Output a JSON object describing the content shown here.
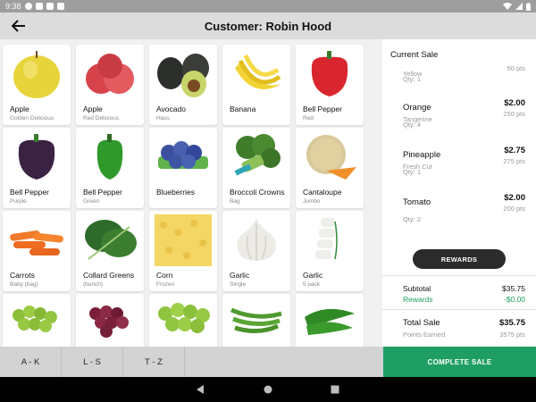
{
  "status_bar": {
    "time": "9:38"
  },
  "header": {
    "title": "Customer: Robin Hood",
    "back_icon": "arrow-left-icon"
  },
  "products": [
    {
      "name": "Apple",
      "sub": "Golden Delicious",
      "icon": "yellow-apple-image"
    },
    {
      "name": "Apple",
      "sub": "Red Delicious",
      "icon": "red-apple-image"
    },
    {
      "name": "Avocado",
      "sub": "Hass",
      "icon": "avocado-image"
    },
    {
      "name": "Banana",
      "sub": "",
      "icon": "banana-image"
    },
    {
      "name": "Bell Pepper",
      "sub": "Red",
      "icon": "red-pepper-image"
    },
    {
      "name": "Bell Pepper",
      "sub": "Purple",
      "icon": "purple-pepper-image"
    },
    {
      "name": "Bell Pepper",
      "sub": "Green",
      "icon": "green-pepper-image"
    },
    {
      "name": "Blueberries",
      "sub": "",
      "icon": "blueberries-image"
    },
    {
      "name": "Broccoli Crowns",
      "sub": "Bag",
      "icon": "broccoli-image"
    },
    {
      "name": "Cantaloupe",
      "sub": "Jumbo",
      "icon": "cantaloupe-image"
    },
    {
      "name": "Carrots",
      "sub": "Baby (bag)",
      "icon": "carrots-image"
    },
    {
      "name": "Collard Greens",
      "sub": "(bunch)",
      "icon": "collard-greens-image"
    },
    {
      "name": "Corn",
      "sub": "Frozen",
      "icon": "corn-image"
    },
    {
      "name": "Garlic",
      "sub": "Single",
      "icon": "garlic-image"
    },
    {
      "name": "Garlic",
      "sub": "5 pack",
      "icon": "garlic-pack-image"
    },
    {
      "name": "",
      "sub": "",
      "icon": "green-grapes-image"
    },
    {
      "name": "",
      "sub": "",
      "icon": "red-grapes-image"
    },
    {
      "name": "",
      "sub": "",
      "icon": "green-grapes-bunch-image"
    },
    {
      "name": "",
      "sub": "",
      "icon": "green-beans-image"
    },
    {
      "name": "",
      "sub": "",
      "icon": "green-chili-image"
    }
  ],
  "sale": {
    "heading": "Current Sale",
    "lines": [
      {
        "name": "",
        "price": "",
        "modifier": "Yellow",
        "points": "50 pts",
        "qty": "Qty: 1"
      },
      {
        "name": "Orange",
        "price": "$2.00",
        "modifier": "Tangerine",
        "points": "250 pts",
        "qty": "Qty: 4"
      },
      {
        "name": "Pineapple",
        "price": "$2.75",
        "modifier": "Fresh Cut",
        "points": "275 pts",
        "qty": "Qty: 1"
      },
      {
        "name": "Tomato",
        "price": "$2.00",
        "modifier": "",
        "points": "200 pts",
        "qty": "Qty: 2"
      }
    ],
    "rewards_label": "REWARDS",
    "subtotal_label": "Subtotal",
    "subtotal_value": "$35.75",
    "rewards_row_label": "Rewards",
    "rewards_row_value": "-$0.00",
    "total_label": "Total Sale",
    "total_value": "$35.75",
    "points_label": "Points Earned",
    "points_value": "3575 pts"
  },
  "tabs": [
    {
      "label": "A - K"
    },
    {
      "label": "L - S"
    },
    {
      "label": "T - Z"
    }
  ],
  "complete_label": "COMPLETE SALE",
  "colors": {
    "accent_green": "#1f9e63",
    "app_bar": "#dcdcdc",
    "status_bar": "#9e9e9e"
  }
}
